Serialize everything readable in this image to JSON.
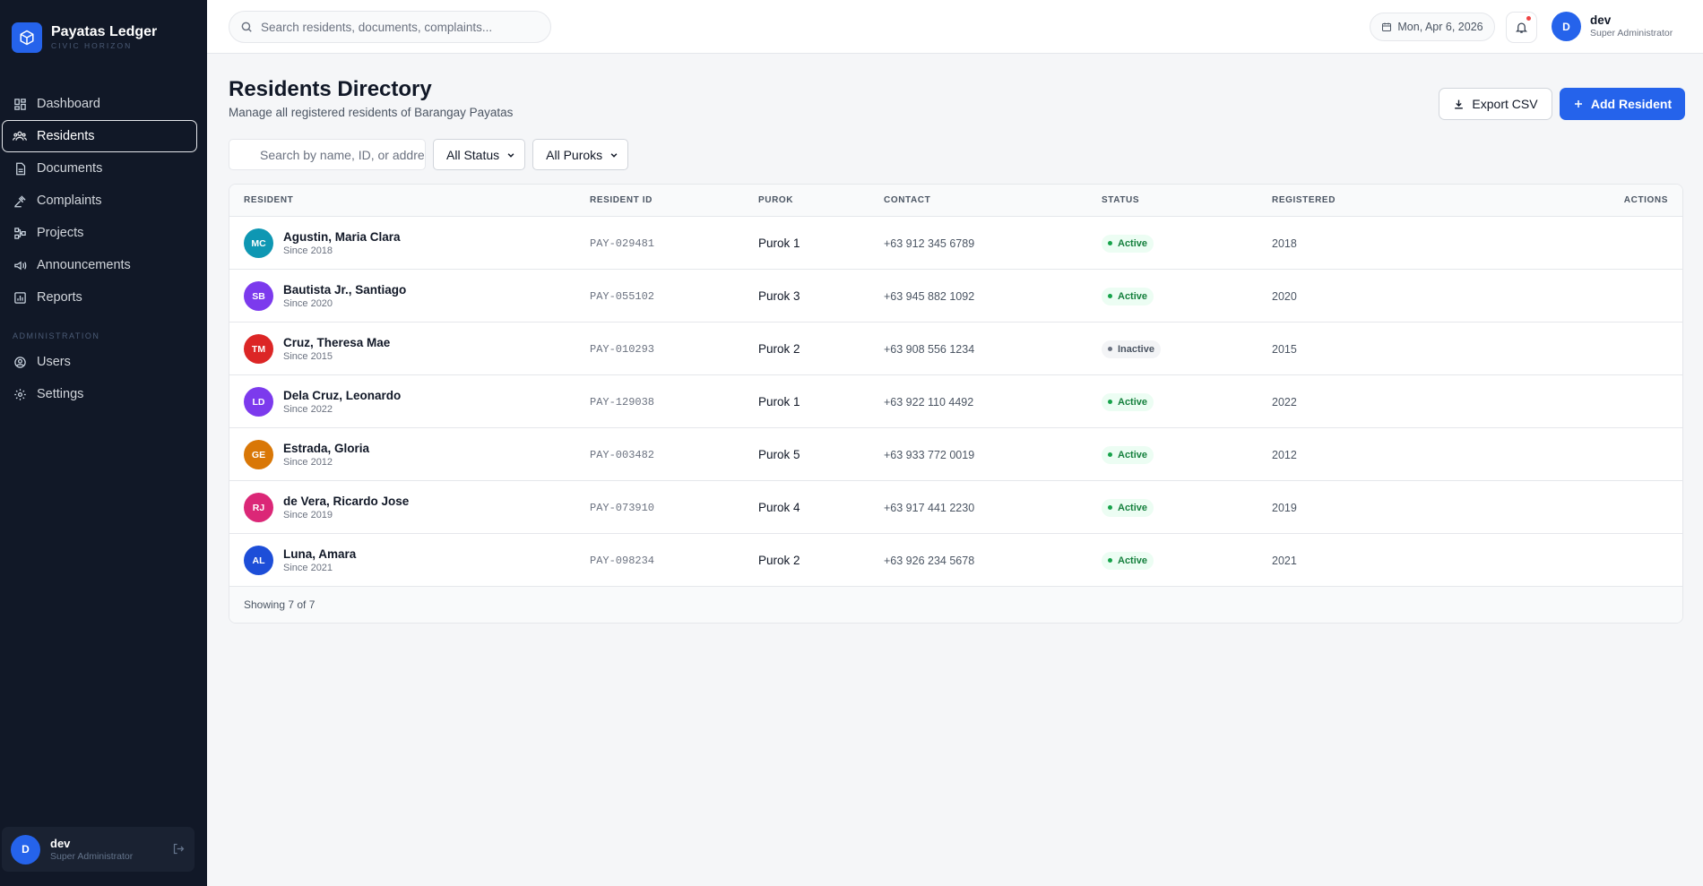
{
  "brand": {
    "title": "Payatas Ledger",
    "subtitle": "CIVIC HORIZON"
  },
  "sidebar": {
    "items": [
      {
        "label": "Dashboard",
        "icon": "dashboard-icon"
      },
      {
        "label": "Residents",
        "icon": "users-icon",
        "active": true
      },
      {
        "label": "Documents",
        "icon": "document-icon"
      },
      {
        "label": "Complaints",
        "icon": "gavel-icon"
      },
      {
        "label": "Projects",
        "icon": "project-icon"
      },
      {
        "label": "Announcements",
        "icon": "megaphone-icon"
      },
      {
        "label": "Reports",
        "icon": "report-icon"
      }
    ],
    "admin_section": "ADMINISTRATION",
    "admin_items": [
      {
        "label": "Users",
        "icon": "user-circle-icon"
      },
      {
        "label": "Settings",
        "icon": "gear-icon"
      }
    ],
    "user": {
      "initial": "D",
      "name": "dev",
      "role": "Super Administrator"
    }
  },
  "topbar": {
    "search_placeholder": "Search residents, documents, complaints...",
    "date": "Mon, Apr 6, 2026",
    "user": {
      "initial": "D",
      "name": "dev",
      "role": "Super Administrator"
    }
  },
  "page": {
    "title": "Residents Directory",
    "subtitle": "Manage all registered residents of Barangay Payatas",
    "export_label": "Export CSV",
    "add_label": "Add Resident"
  },
  "filters": {
    "search_placeholder": "Search by name, ID, or address...",
    "status_value": "All Status",
    "purok_value": "All Puroks"
  },
  "table": {
    "headers": {
      "resident": "RESIDENT",
      "resident_id": "RESIDENT ID",
      "purok": "PUROK",
      "contact": "CONTACT",
      "status": "STATUS",
      "registered": "REGISTERED",
      "actions": "ACTIONS"
    },
    "rows": [
      {
        "initials": "MC",
        "color": "#0e97b3",
        "name": "Agustin, Maria Clara",
        "since": "Since 2018",
        "id": "PAY-029481",
        "purok": "Purok 1",
        "contact": "+63 912 345 6789",
        "status": "Active",
        "registered": "2018"
      },
      {
        "initials": "SB",
        "color": "#7c3aed",
        "name": "Bautista Jr., Santiago",
        "since": "Since 2020",
        "id": "PAY-055102",
        "purok": "Purok 3",
        "contact": "+63 945 882 1092",
        "status": "Active",
        "registered": "2020"
      },
      {
        "initials": "TM",
        "color": "#dc2626",
        "name": "Cruz, Theresa Mae",
        "since": "Since 2015",
        "id": "PAY-010293",
        "purok": "Purok 2",
        "contact": "+63 908 556 1234",
        "status": "Inactive",
        "registered": "2015"
      },
      {
        "initials": "LD",
        "color": "#7c3aed",
        "name": "Dela Cruz, Leonardo",
        "since": "Since 2022",
        "id": "PAY-129038",
        "purok": "Purok 1",
        "contact": "+63 922 110 4492",
        "status": "Active",
        "registered": "2022"
      },
      {
        "initials": "GE",
        "color": "#d97706",
        "name": "Estrada, Gloria",
        "since": "Since 2012",
        "id": "PAY-003482",
        "purok": "Purok 5",
        "contact": "+63 933 772 0019",
        "status": "Active",
        "registered": "2012"
      },
      {
        "initials": "RJ",
        "color": "#db2777",
        "name": "de Vera, Ricardo Jose",
        "since": "Since 2019",
        "id": "PAY-073910",
        "purok": "Purok 4",
        "contact": "+63 917 441 2230",
        "status": "Active",
        "registered": "2019"
      },
      {
        "initials": "AL",
        "color": "#1d4ed8",
        "name": "Luna, Amara",
        "since": "Since 2021",
        "id": "PAY-098234",
        "purok": "Purok 2",
        "contact": "+63 926 234 5678",
        "status": "Active",
        "registered": "2021"
      }
    ],
    "footer": "Showing 7 of 7"
  },
  "colors": {
    "sidebar_bg": "#111827",
    "accent": "#2563eb",
    "page_bg": "#f5f6f8"
  }
}
